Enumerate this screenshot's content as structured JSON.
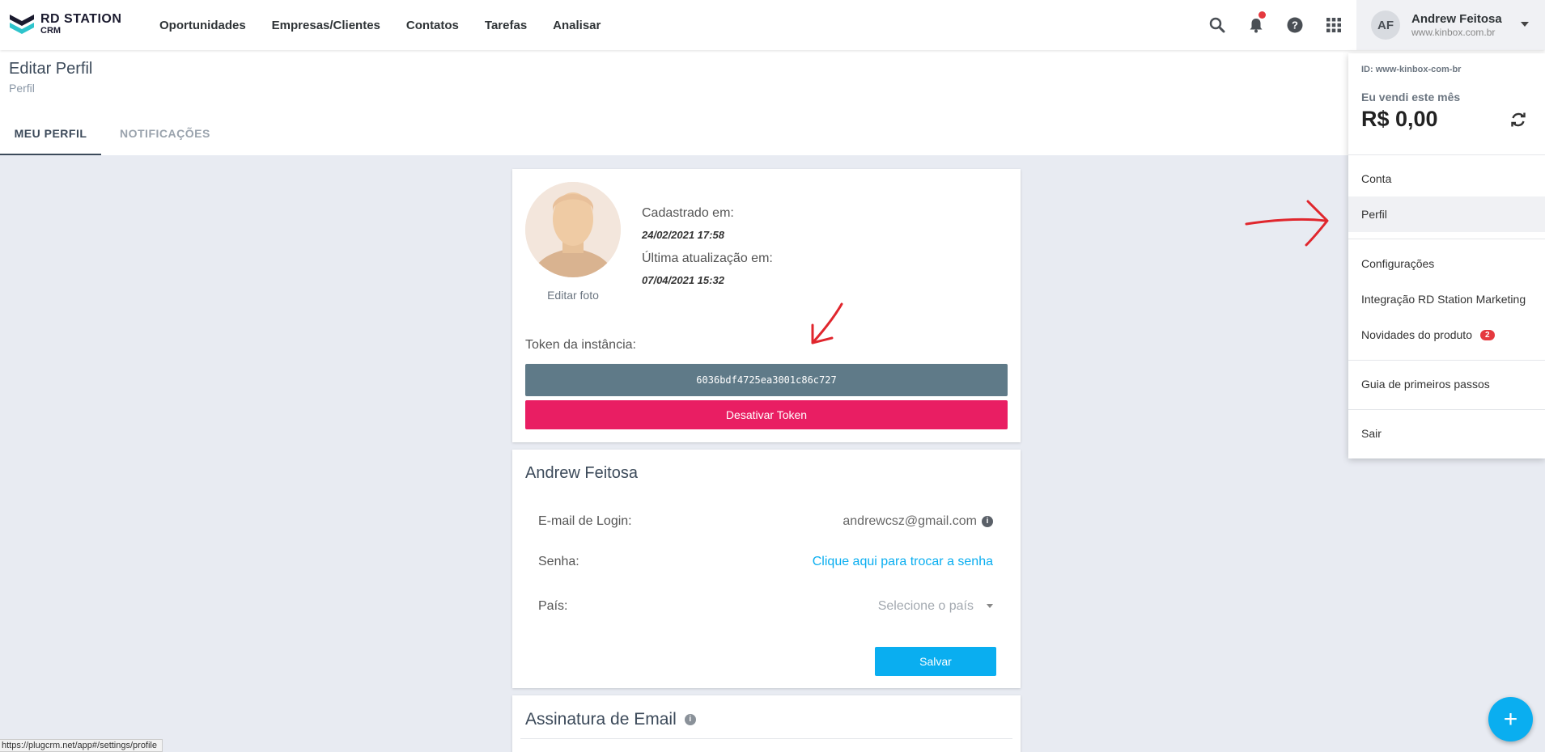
{
  "brand": {
    "line1_bold": "RD",
    "line1": " STATION",
    "line2": "CRM"
  },
  "nav": {
    "items": [
      "Oportunidades",
      "Empresas/Clientes",
      "Contatos",
      "Tarefas",
      "Analisar"
    ]
  },
  "user": {
    "initials": "AF",
    "name": "Andrew Feitosa",
    "site": "www.kinbox.com.br"
  },
  "page": {
    "title": "Editar Perfil",
    "subtitle": "Perfil"
  },
  "tabs": [
    {
      "label": "MEU PERFIL"
    },
    {
      "label": "NOTIFICAÇÕES"
    }
  ],
  "profile": {
    "edit_photo": "Editar foto",
    "registered_label": "Cadastrado em:",
    "registered_value": "24/02/2021 17:58",
    "updated_label": "Última atualização em:",
    "updated_value": "07/04/2021 15:32",
    "token_label": "Token da instância:",
    "token_value": "6036bdf4725ea3001c86c727",
    "token_button": "Desativar Token"
  },
  "account": {
    "name": "Andrew Feitosa",
    "email_label": "E-mail de Login:",
    "email_value": "andrewcsz@gmail.com",
    "password_label": "Senha:",
    "password_link": "Clique aqui para trocar a senha",
    "country_label": "País:",
    "country_placeholder": "Selecione o país",
    "save_button": "Salvar"
  },
  "signature": {
    "title": "Assinatura de Email"
  },
  "dropdown": {
    "id_text": "ID: www-kinbox-com-br",
    "sold_label": "Eu vendi este mês",
    "sold_value": "R$ 0,00",
    "items": {
      "conta": "Conta",
      "perfil": "Perfil",
      "configuracoes": "Configurações",
      "integracao": "Integração RD Station Marketing",
      "novidades": "Novidades do produto",
      "novidades_badge": "2",
      "guia": "Guia de primeiros passos",
      "sair": "Sair"
    }
  },
  "status_bar": {
    "url": "https://plugcrm.net/app#/settings/profile"
  },
  "fab": {
    "label": "+"
  },
  "colors": {
    "accent": "#0aaef0",
    "danger": "#e91e63",
    "token_bg": "#5f7a88",
    "annotation": "#e0262d"
  }
}
